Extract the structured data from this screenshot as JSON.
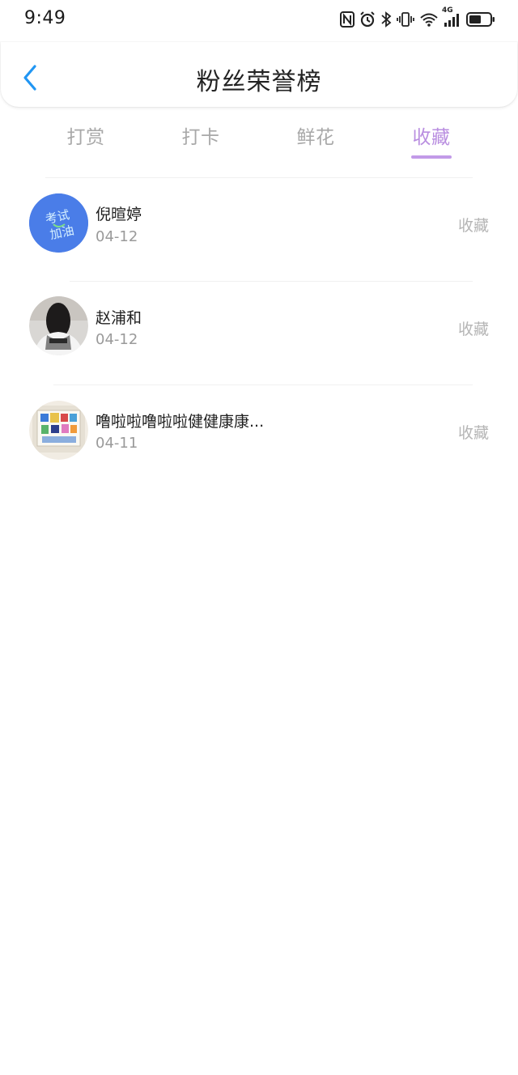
{
  "status_bar": {
    "time": "9:49",
    "network": "4G",
    "icons": [
      "nfc-icon",
      "alarm-icon",
      "bluetooth-icon",
      "vibrate-icon",
      "wifi-icon",
      "signal-icon",
      "battery-icon"
    ]
  },
  "header": {
    "title": "粉丝荣誉榜",
    "back_icon": "chevron-left-icon"
  },
  "tabs": [
    {
      "label": "打赏",
      "active": false
    },
    {
      "label": "打卡",
      "active": false
    },
    {
      "label": "鲜花",
      "active": false
    },
    {
      "label": "收藏",
      "active": true
    }
  ],
  "list": [
    {
      "name": "倪暄婷",
      "date": "04-12",
      "action": "收藏",
      "avatar_text": "考试加油"
    },
    {
      "name": "赵浦和",
      "date": "04-12",
      "action": "收藏"
    },
    {
      "name": "噜啦啦噜啦啦健健康康...",
      "date": "04-11",
      "action": "收藏"
    }
  ],
  "colors": {
    "accent": "#b98ee0",
    "back_icon": "#2196f3",
    "tab_inactive": "#a8a8a8"
  }
}
